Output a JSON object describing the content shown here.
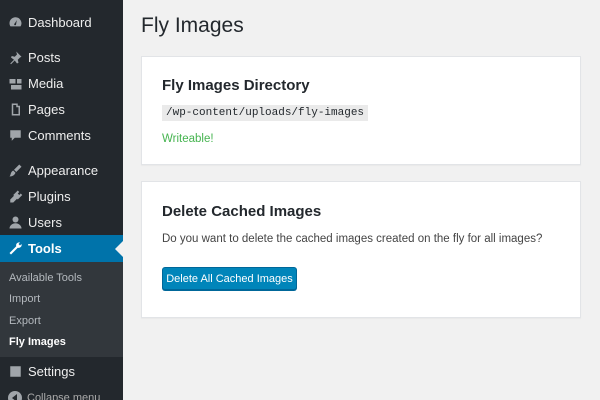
{
  "sidebar": {
    "items": [
      {
        "label": "Dashboard",
        "icon": "dashboard-icon"
      },
      {
        "label": "Posts",
        "icon": "pin-icon"
      },
      {
        "label": "Media",
        "icon": "media-icon"
      },
      {
        "label": "Pages",
        "icon": "page-icon"
      },
      {
        "label": "Comments",
        "icon": "comment-icon"
      },
      {
        "label": "Appearance",
        "icon": "brush-icon"
      },
      {
        "label": "Plugins",
        "icon": "plugin-icon"
      },
      {
        "label": "Users",
        "icon": "user-icon"
      },
      {
        "label": "Tools",
        "icon": "wrench-icon"
      },
      {
        "label": "Settings",
        "icon": "settings-icon"
      }
    ],
    "submenu": [
      "Available Tools",
      "Import",
      "Export",
      "Fly Images"
    ],
    "collapse_label": "Collapse menu",
    "accent_color": "#0073aa"
  },
  "main": {
    "title": "Fly Images",
    "directory_card": {
      "heading": "Fly Images Directory",
      "path": "/wp-content/uploads/fly-images",
      "status": "Writeable!",
      "status_color": "#46b450"
    },
    "cache_card": {
      "heading": "Delete Cached Images",
      "description": "Do you want to delete the cached images created on the fly for all images?",
      "button_label": "Delete All Cached Images"
    }
  }
}
